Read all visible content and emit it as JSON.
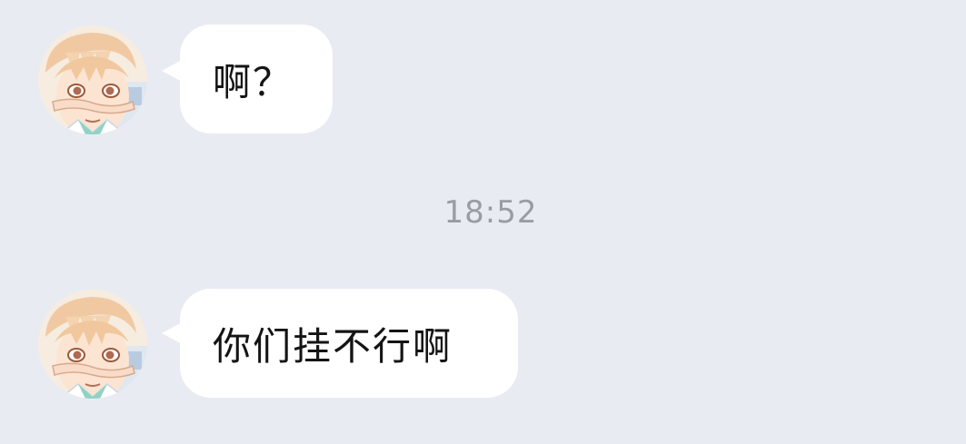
{
  "messages": [
    {
      "sender": "other",
      "avatar": "anime-character-avatar",
      "text": "啊？"
    },
    {
      "sender": "other",
      "avatar": "anime-character-avatar",
      "text": "你们挂不行啊"
    }
  ],
  "timestamp": "18:52",
  "colors": {
    "background": "#e9ebf3",
    "bubble": "#ffffff",
    "text": "#141414",
    "timestamp": "#9a9ca4"
  }
}
